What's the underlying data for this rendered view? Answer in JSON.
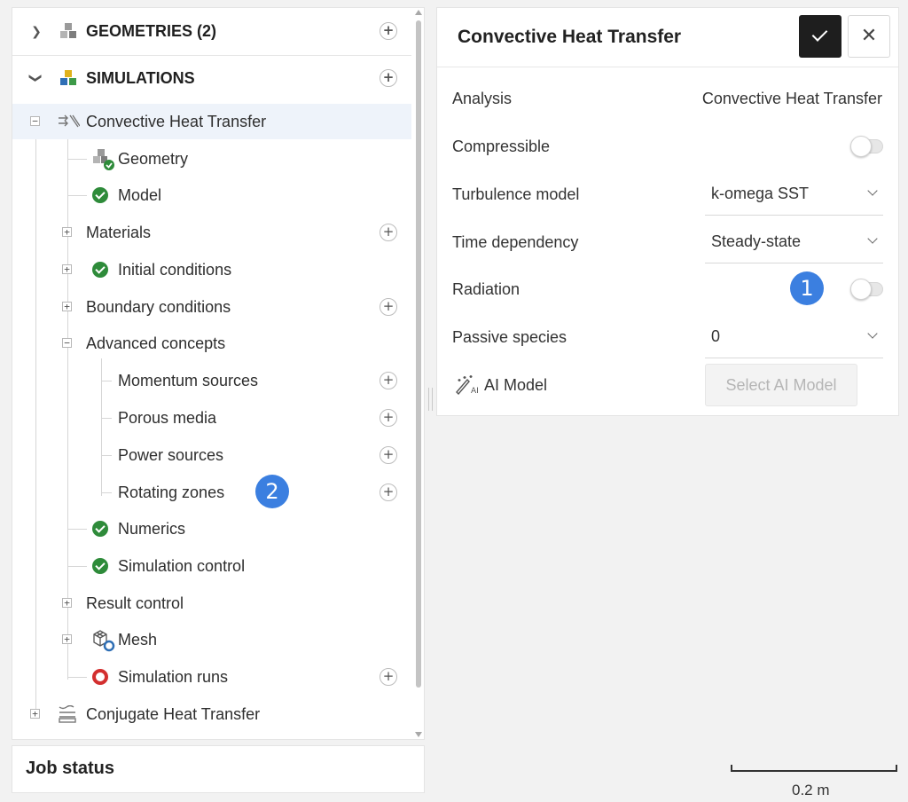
{
  "tree": {
    "geometries": {
      "label": "GEOMETRIES (2)"
    },
    "simulations": {
      "label": "SIMULATIONS"
    },
    "items": {
      "convective": "Convective Heat Transfer",
      "geometry": "Geometry",
      "model": "Model",
      "materials": "Materials",
      "initial_conditions": "Initial conditions",
      "boundary_conditions": "Boundary conditions",
      "advanced_concepts": "Advanced concepts",
      "momentum_sources": "Momentum sources",
      "porous_media": "Porous media",
      "power_sources": "Power sources",
      "rotating_zones": "Rotating zones",
      "numerics": "Numerics",
      "simulation_control": "Simulation control",
      "result_control": "Result control",
      "mesh": "Mesh",
      "simulation_runs": "Simulation runs",
      "conjugate": "Conjugate Heat Transfer"
    }
  },
  "job_status": {
    "label": "Job status"
  },
  "panel": {
    "title": "Convective Heat Transfer",
    "analysis": {
      "label": "Analysis",
      "value": "Convective Heat Transfer"
    },
    "compressible": {
      "label": "Compressible",
      "on": false
    },
    "turbulence": {
      "label": "Turbulence model",
      "value": "k-omega SST"
    },
    "time_dependency": {
      "label": "Time dependency",
      "value": "Steady-state"
    },
    "radiation": {
      "label": "Radiation",
      "on": false
    },
    "passive_species": {
      "label": "Passive species",
      "value": "0"
    },
    "ai_model": {
      "label": "AI Model",
      "button": "Select AI Model"
    }
  },
  "badges": {
    "one": "1",
    "two": "2"
  },
  "scale": {
    "label": "0.2 m"
  },
  "colors": {
    "accent": "#3b7fe0",
    "check": "#2e8b3a",
    "runs": "#d32f2f",
    "confirm": "#1e1e1e"
  }
}
